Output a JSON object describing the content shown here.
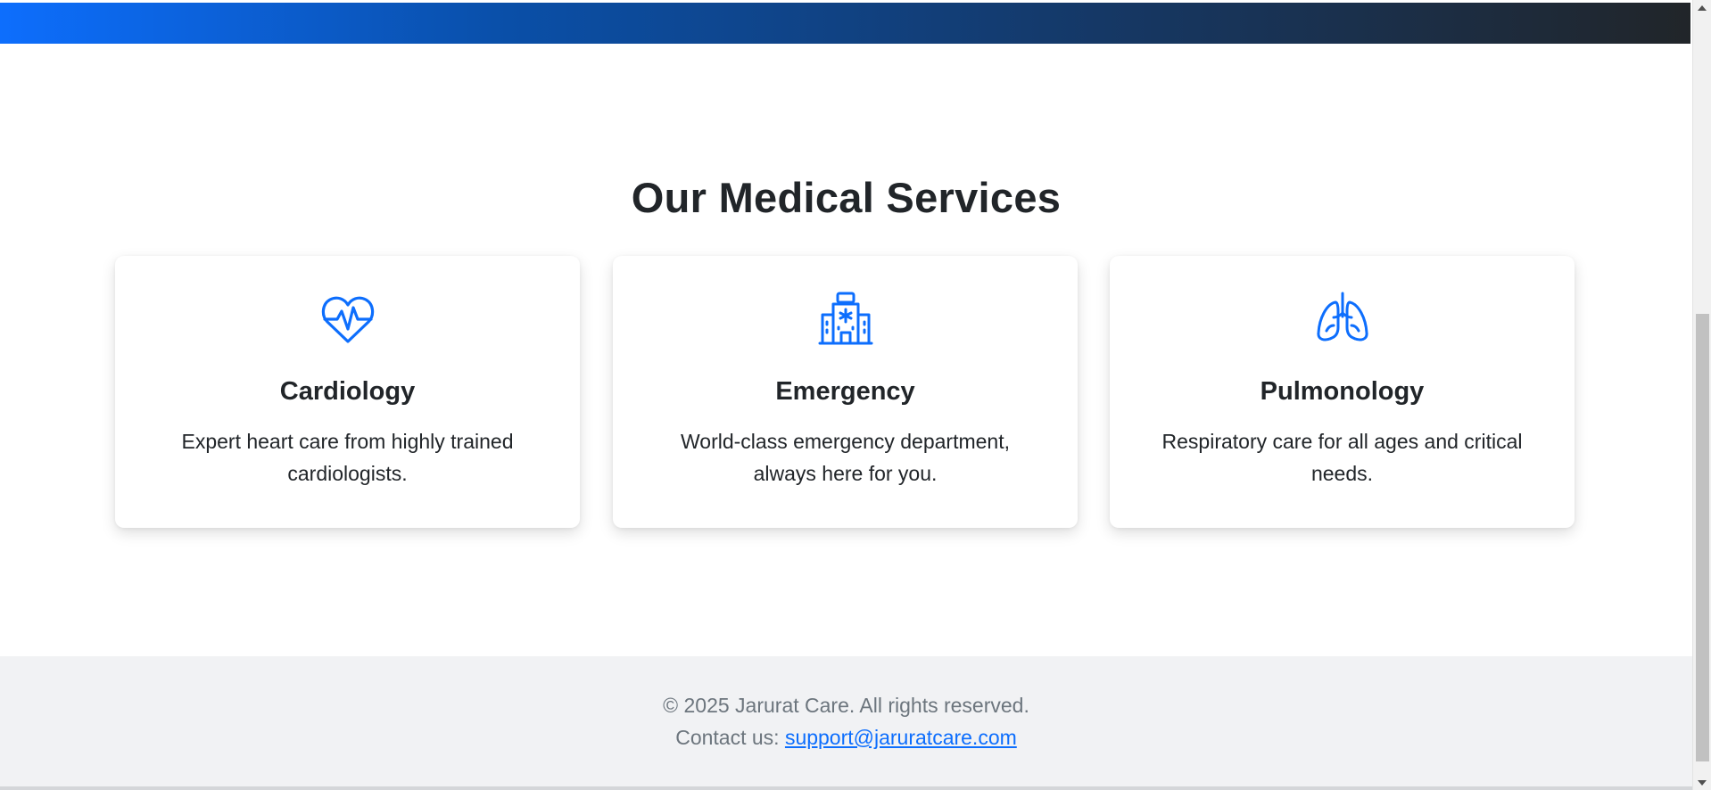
{
  "colors": {
    "accent": "#0d6efd",
    "heading": "#212529",
    "muted": "#6c757d",
    "footer_bg": "#f1f2f4",
    "hero_gradient_start": "#0d6efd",
    "hero_gradient_end": "#212529"
  },
  "services": {
    "title": "Our Medical Services",
    "cards": [
      {
        "icon": "heart-pulse-icon",
        "title": "Cardiology",
        "text": "Expert heart care from highly trained cardiologists."
      },
      {
        "icon": "hospital-icon",
        "title": "Emergency",
        "text": "World-class emergency department, always here for you."
      },
      {
        "icon": "lungs-icon",
        "title": "Pulmonology",
        "text": "Respiratory care for all ages and critical needs."
      }
    ]
  },
  "footer": {
    "copyright": "© 2025 Jarurat Care. All rights reserved.",
    "contact_prefix": "Contact us: ",
    "contact_email": "support@jaruratcare.com"
  }
}
